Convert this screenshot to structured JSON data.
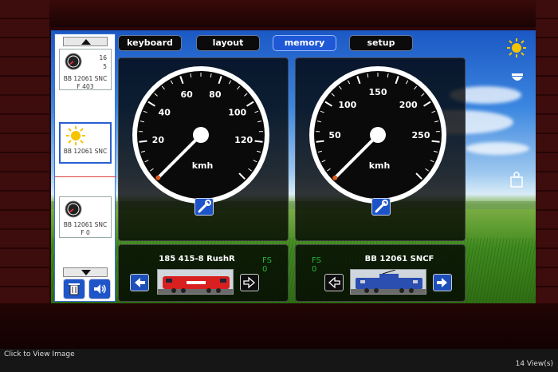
{
  "tabs": [
    {
      "label": "keyboard",
      "active": false
    },
    {
      "label": "layout",
      "active": false
    },
    {
      "label": "memory",
      "active": true
    },
    {
      "label": "setup",
      "active": false
    }
  ],
  "sidebar": {
    "items": [
      {
        "name": "BB 12061 SNC",
        "function": "F 403",
        "number_top": "16",
        "number_bottom": "5",
        "icon": "speedometer-icon"
      },
      {
        "name": "BB 12061 SNC",
        "function": "",
        "icon": "sun-icon",
        "selected": true
      },
      {
        "name": "BB 12061 SNC",
        "function": "F 0",
        "icon": "speedometer-icon"
      }
    ],
    "buttons": [
      {
        "icon": "trash-icon"
      },
      {
        "icon": "speaker-icon"
      }
    ]
  },
  "gauge_left": {
    "unit": "kmh",
    "ticks": [
      "20",
      "40",
      "60",
      "80",
      "100",
      "120"
    ],
    "max": 140,
    "speed": 0
  },
  "gauge_right": {
    "unit": "kmh",
    "ticks": [
      "50",
      "100",
      "150",
      "200",
      "250"
    ],
    "max": 300,
    "speed": 0
  },
  "loco_left": {
    "name": "185 415-8 RushR",
    "fs_label": "FS",
    "fs_value": "0",
    "color": "#d82020"
  },
  "loco_right": {
    "name": "BB 12061 SNCF",
    "fs_label": "FS",
    "fs_value": "0",
    "color": "#2a4fb0"
  },
  "right_icons": [
    "sun-icon",
    "dome-light-icon",
    "weight-icon"
  ],
  "status": {
    "left": "Click to View Image",
    "right": "14 View(s)"
  },
  "colors": {
    "accent": "#1f58d6",
    "fs_green": "#29b43a",
    "needle": "#ffffff"
  }
}
